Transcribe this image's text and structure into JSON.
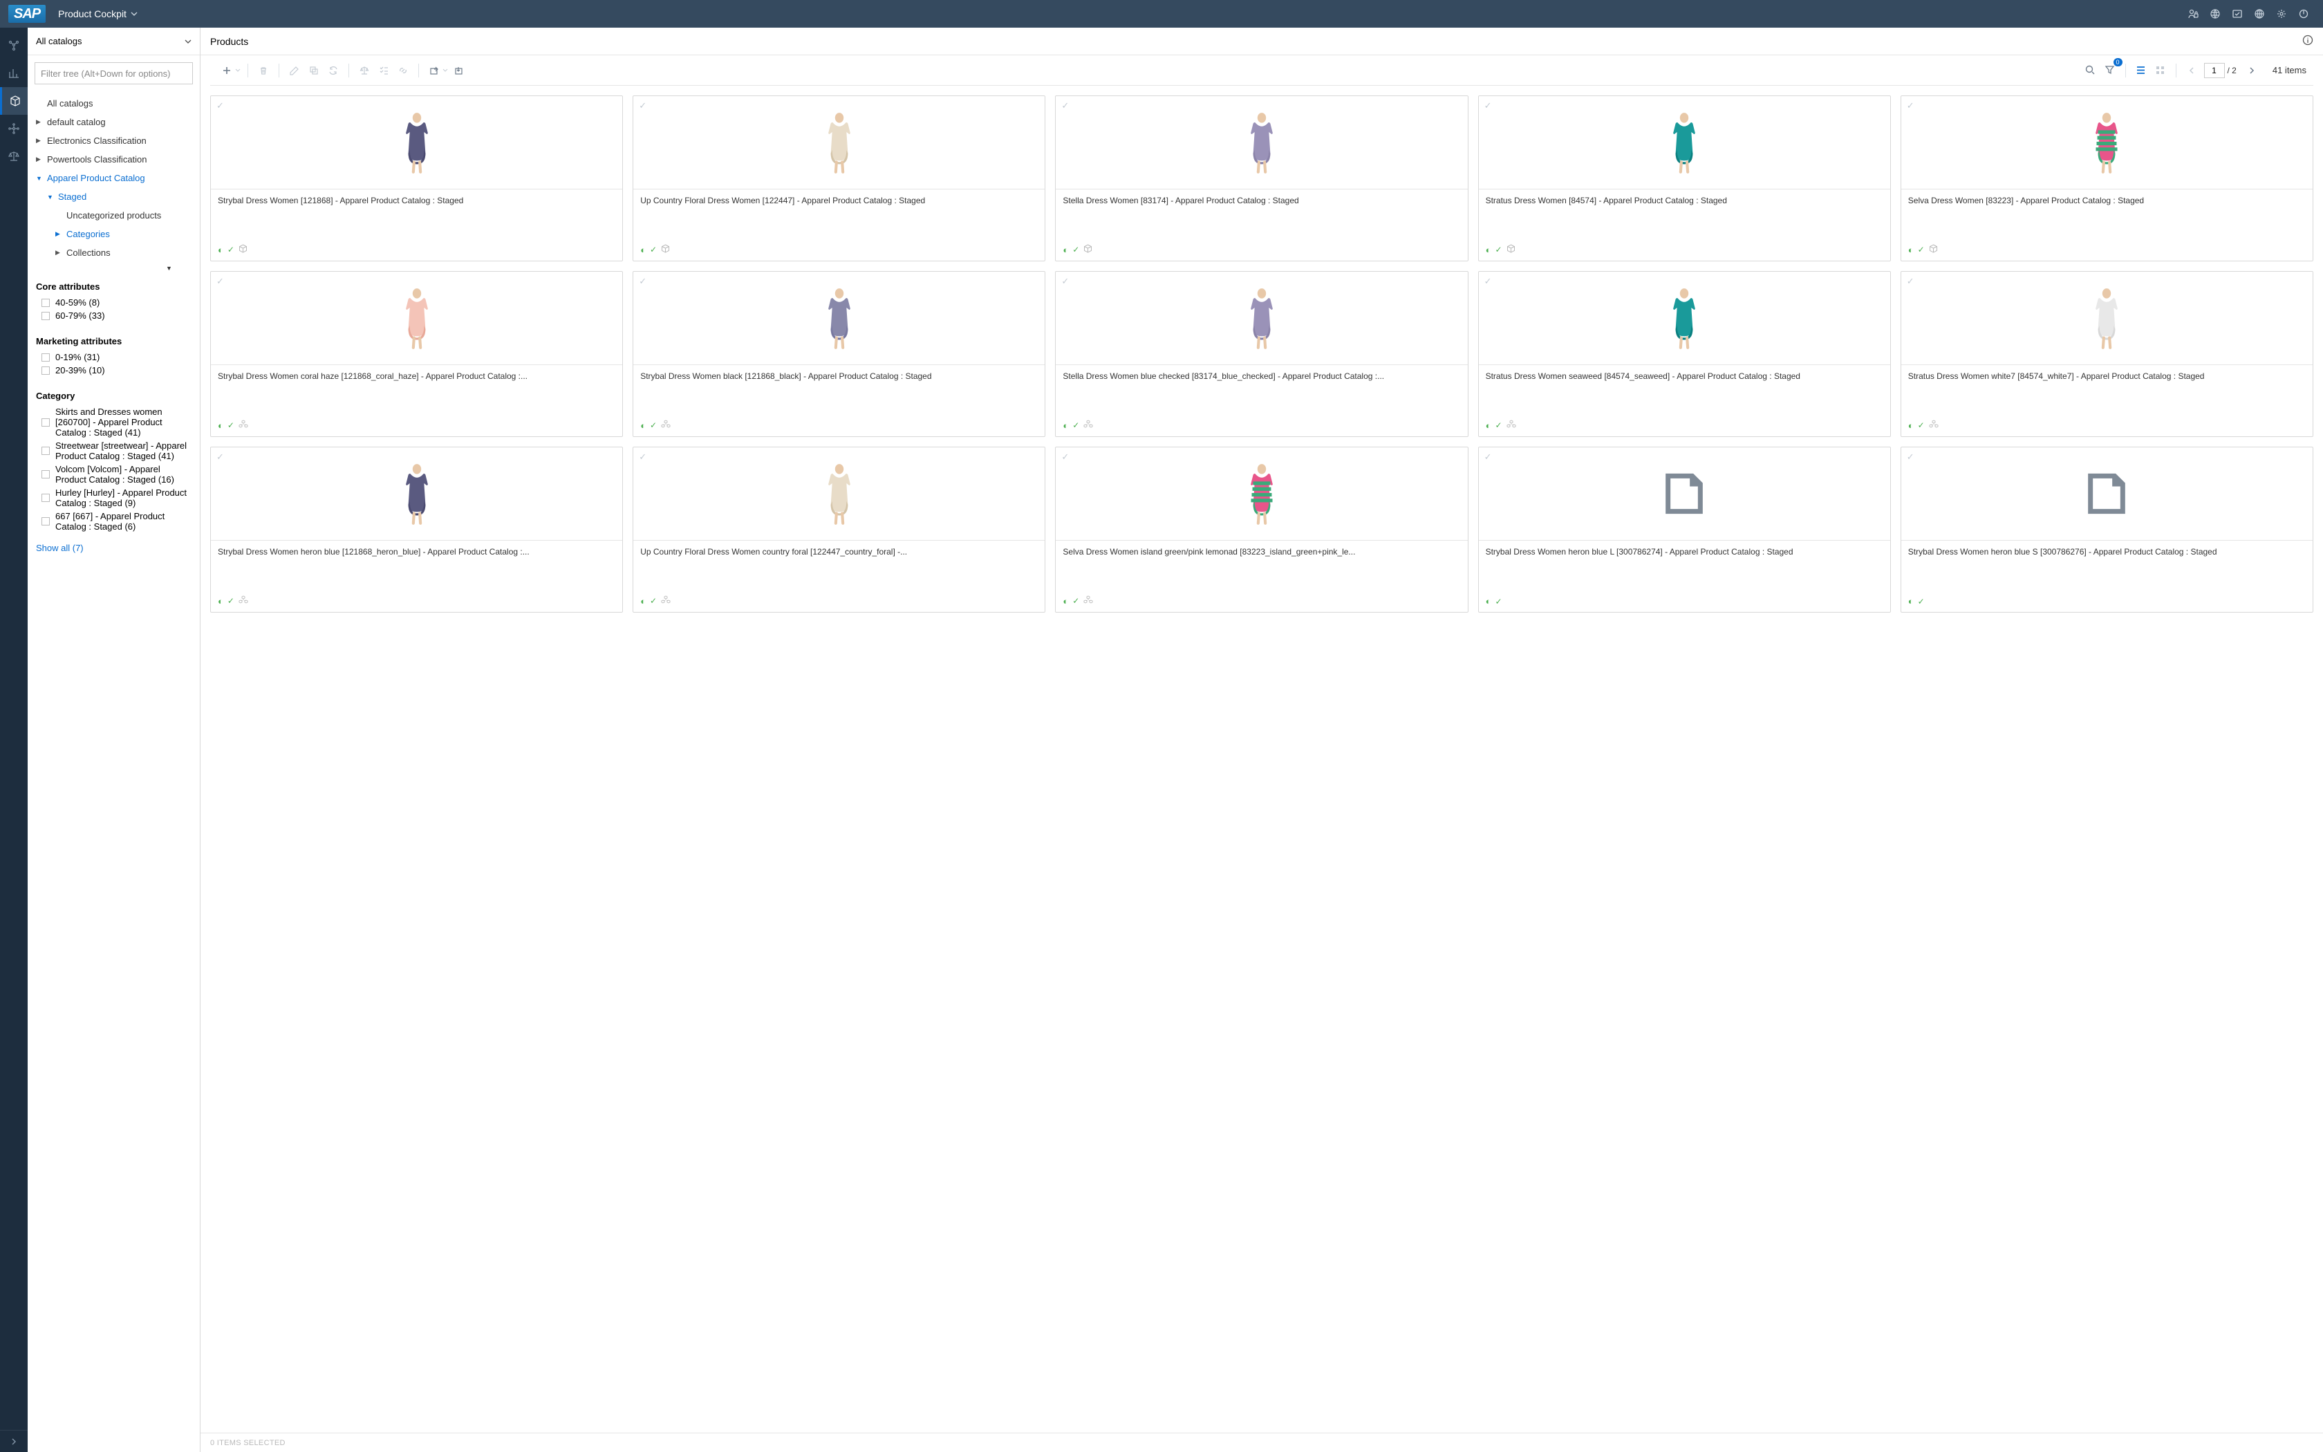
{
  "header": {
    "logo": "SAP",
    "title": "Product Cockpit"
  },
  "leftpanel": {
    "catalog_selector": "All catalogs",
    "filter_placeholder": "Filter tree (Alt+Down for options)",
    "tree": [
      {
        "label": "All catalogs",
        "depth": 0,
        "expandable": false,
        "active": false
      },
      {
        "label": "default catalog",
        "depth": 0,
        "expandable": true,
        "active": false
      },
      {
        "label": "Electronics Classification",
        "depth": 0,
        "expandable": true,
        "active": false
      },
      {
        "label": "Powertools Classification",
        "depth": 0,
        "expandable": true,
        "active": false
      },
      {
        "label": "Apparel Product Catalog",
        "depth": 0,
        "expandable": true,
        "active": true,
        "expanded": true
      },
      {
        "label": "Staged",
        "depth": 1,
        "expandable": true,
        "active": true,
        "expanded": true
      },
      {
        "label": "Uncategorized products",
        "depth": 2,
        "expandable": false,
        "active": false
      },
      {
        "label": "Categories",
        "depth": 2,
        "expandable": true,
        "active": true
      },
      {
        "label": "Collections",
        "depth": 2,
        "expandable": true,
        "active": false
      }
    ],
    "facets": [
      {
        "title": "Core attributes",
        "items": [
          {
            "label": "40-59% (8)"
          },
          {
            "label": "60-79% (33)"
          }
        ]
      },
      {
        "title": "Marketing attributes",
        "items": [
          {
            "label": "0-19% (31)"
          },
          {
            "label": "20-39% (10)"
          }
        ]
      },
      {
        "title": "Category",
        "items": [
          {
            "label": "Skirts and Dresses women [260700] - Apparel Product Catalog : Staged (41)"
          },
          {
            "label": "Streetwear [streetwear] - Apparel Product Catalog : Staged (41)"
          },
          {
            "label": "Volcom [Volcom] - Apparel Product Catalog : Staged (16)"
          },
          {
            "label": "Hurley [Hurley] - Apparel Product Catalog : Staged (9)"
          },
          {
            "label": "667 [667] - Apparel Product Catalog : Staged (6)"
          }
        ]
      }
    ],
    "show_all": "Show all (7)"
  },
  "main": {
    "title": "Products",
    "page_current": "1",
    "page_total": "/ 2",
    "item_count": "41 items",
    "filter_badge": "0",
    "footer": "0 ITEMS SELECTED"
  },
  "products": [
    {
      "title": "Strybal Dress Women [121868] - Apparel Product Catalog : Staged",
      "variant": "purple",
      "cube": "outline"
    },
    {
      "title": "Up Country Floral Dress Women [122447] - Apparel Product Catalog : Staged",
      "variant": "floral",
      "cube": "outline"
    },
    {
      "title": "Stella Dress Women [83174] - Apparel Product Catalog : Staged",
      "variant": "lavender",
      "cube": "outline"
    },
    {
      "title": "Stratus Dress Women [84574] - Apparel Product Catalog : Staged",
      "variant": "teal",
      "cube": "outline"
    },
    {
      "title": "Selva Dress Women [83223] - Apparel Product Catalog : Staged",
      "variant": "stripe",
      "cube": "outline"
    },
    {
      "title": "Strybal Dress Women coral haze [121868_coral_haze] - Apparel Product Catalog :...",
      "variant": "coral",
      "cube": "cluster"
    },
    {
      "title": "Strybal Dress Women black [121868_black] - Apparel Product Catalog : Staged",
      "variant": "lavender2",
      "cube": "cluster"
    },
    {
      "title": "Stella Dress Women blue checked [83174_blue_checked] - Apparel Product Catalog :...",
      "variant": "lavender",
      "cube": "cluster"
    },
    {
      "title": "Stratus Dress Women seaweed [84574_seaweed] - Apparel Product Catalog : Staged",
      "variant": "teal",
      "cube": "cluster"
    },
    {
      "title": "Stratus Dress Women white7 [84574_white7] - Apparel Product Catalog : Staged",
      "variant": "white",
      "cube": "cluster"
    },
    {
      "title": "Strybal Dress Women heron blue [121868_heron_blue] - Apparel Product Catalog :...",
      "variant": "purple",
      "cube": "cluster"
    },
    {
      "title": "Up Country Floral Dress Women country foral [122447_country_foral] -...",
      "variant": "floral",
      "cube": "cluster"
    },
    {
      "title": "Selva Dress Women island green/pink lemonad [83223_island_green+pink_le...",
      "variant": "stripe",
      "cube": "cluster"
    },
    {
      "title": "Strybal Dress Women heron blue L [300786274] - Apparel Product Catalog : Staged",
      "variant": "placeholder",
      "cube": "none"
    },
    {
      "title": "Strybal Dress Women heron blue S [300786276] - Apparel Product Catalog : Staged",
      "variant": "placeholder",
      "cube": "none"
    }
  ]
}
